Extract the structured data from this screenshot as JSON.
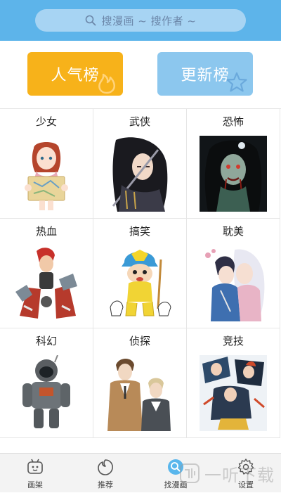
{
  "search": {
    "placeholder": "搜漫画 ~ 搜作者 ~"
  },
  "hero": {
    "popular_label": "人气榜",
    "updated_label": "更新榜"
  },
  "categories": [
    {
      "label": "少女",
      "icon": "girl-holding-map-icon"
    },
    {
      "label": "武侠",
      "icon": "swordsman-icon"
    },
    {
      "label": "恐怖",
      "icon": "ghost-woman-icon"
    },
    {
      "label": "热血",
      "icon": "fighter-with-mech-icon"
    },
    {
      "label": "搞笑",
      "icon": "kid-with-helmet-icon"
    },
    {
      "label": "耽美",
      "icon": "embracing-couple-icon"
    },
    {
      "label": "科幻",
      "icon": "astronaut-icon"
    },
    {
      "label": "侦探",
      "icon": "detectives-icon"
    },
    {
      "label": "竞技",
      "icon": "sports-team-icon"
    }
  ],
  "tabbar": {
    "tabs": [
      {
        "label": "画架",
        "icon": "shelf-icon",
        "active": false
      },
      {
        "label": "推荐",
        "icon": "recommend-icon",
        "active": false
      },
      {
        "label": "找漫画",
        "icon": "find-comic-icon",
        "active": true
      },
      {
        "label": "设置",
        "icon": "gear-icon",
        "active": false
      }
    ]
  },
  "watermark": {
    "text": "一听下载"
  },
  "colors": {
    "topbar": "#5db4ea",
    "popular": "#f7b21a",
    "updated": "#8cc7ee"
  }
}
